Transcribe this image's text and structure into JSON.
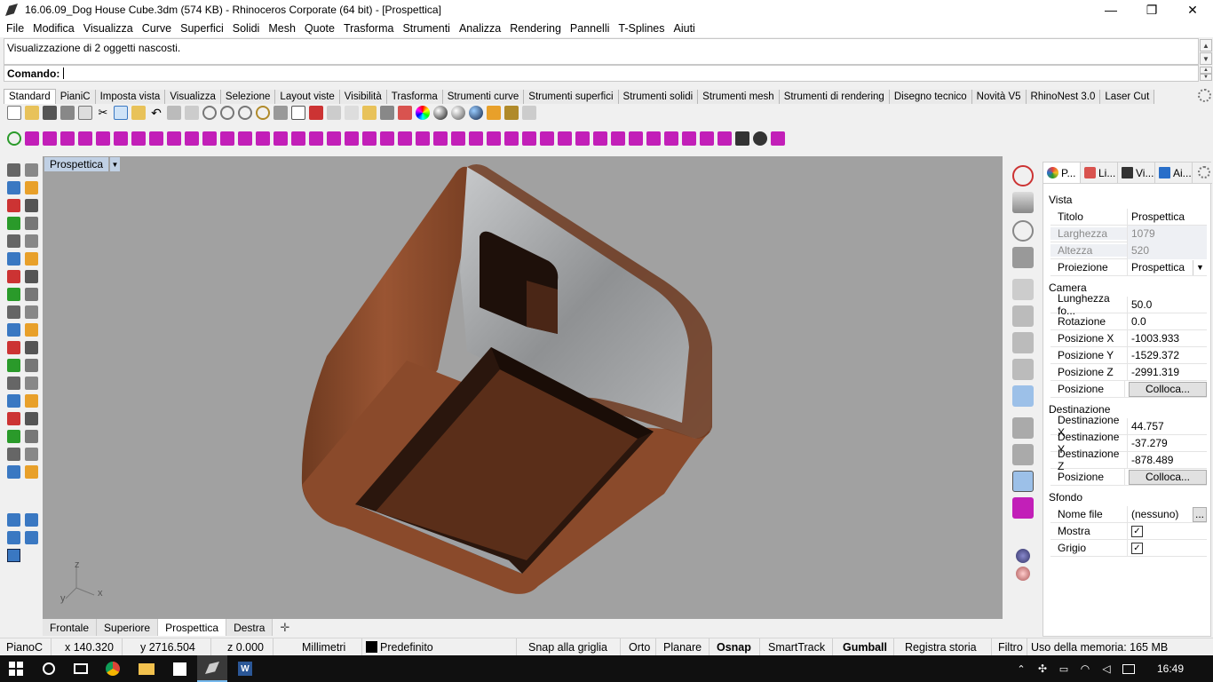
{
  "window": {
    "title": "16.06.09_Dog House Cube.3dm (574 KB) - Rhinoceros Corporate (64 bit) - [Prospettica]",
    "minimize": "—",
    "restore": "❐",
    "close": "✕"
  },
  "menu": [
    "File",
    "Modifica",
    "Visualizza",
    "Curve",
    "Superfici",
    "Solidi",
    "Mesh",
    "Quote",
    "Trasforma",
    "Strumenti",
    "Analizza",
    "Rendering",
    "Pannelli",
    "T-Splines",
    "Aiuti"
  ],
  "command": {
    "history": "Visualizzazione di 2 oggetti nascosti.",
    "prompt": "Comando:"
  },
  "toolbar_tabs": [
    "Standard",
    "PianiC",
    "Imposta vista",
    "Visualizza",
    "Selezione",
    "Layout viste",
    "Visibilità",
    "Trasforma",
    "Strumenti curve",
    "Strumenti superfici",
    "Strumenti solidi",
    "Strumenti mesh",
    "Strumenti di rendering",
    "Disegno tecnico",
    "Novità V5",
    "RhinoNest 3.0",
    "Laser Cut"
  ],
  "viewport": {
    "label": "Prospettica",
    "axes": {
      "z": "z",
      "y": "y",
      "x": "x"
    }
  },
  "viewport_tabs": [
    "Frontale",
    "Superiore",
    "Prospettica",
    "Destra"
  ],
  "panel": {
    "tabs": [
      {
        "label": "P...",
        "color": "#e8413a"
      },
      {
        "label": "Li...",
        "color": "#d9534f"
      },
      {
        "label": "Vi...",
        "color": "#333333"
      },
      {
        "label": "Ai...",
        "color": "#2a6fc9"
      }
    ],
    "sections": {
      "vista": "Vista",
      "camera": "Camera",
      "destinazione": "Destinazione",
      "sfondo": "Sfondo"
    },
    "vista_rows": [
      {
        "k": "Titolo",
        "v": "Prospettica"
      },
      {
        "k": "Larghezza",
        "v": "1079"
      },
      {
        "k": "Altezza",
        "v": "520"
      },
      {
        "k": "Proiezione",
        "v": "Prospettica"
      }
    ],
    "camera_rows": [
      {
        "k": "Lunghezza fo...",
        "v": "50.0"
      },
      {
        "k": "Rotazione",
        "v": "0.0"
      },
      {
        "k": "Posizione X",
        "v": "-1003.933"
      },
      {
        "k": "Posizione Y",
        "v": "-1529.372"
      },
      {
        "k": "Posizione Z",
        "v": "-2991.319"
      },
      {
        "k": "Posizione",
        "v": "Colloca..."
      }
    ],
    "dest_rows": [
      {
        "k": "Destinazione X",
        "v": "44.757"
      },
      {
        "k": "Destinazione Y",
        "v": "-37.279"
      },
      {
        "k": "Destinazione Z",
        "v": "-878.489"
      },
      {
        "k": "Posizione",
        "v": "Colloca..."
      }
    ],
    "sfondo_rows": [
      {
        "k": "Nome file",
        "v": "(nessuno)"
      },
      {
        "k": "Mostra",
        "v": "✓"
      },
      {
        "k": "Grigio",
        "v": "✓"
      }
    ],
    "browse": "..."
  },
  "status": {
    "layer": "PianoC",
    "x": "x 140.320",
    "y": "y 2716.504",
    "z": "z 0.000",
    "units": "Millimetri",
    "layer_color": "#000000",
    "default_layer": "Predefinito",
    "snap": "Snap alla griglia",
    "orto": "Orto",
    "planare": "Planare",
    "osnap": "Osnap",
    "smarttrack": "SmartTrack",
    "gumball": "Gumball",
    "history": "Registra storia",
    "filtro": "Filtro",
    "memory": "Uso della memoria: 165 MB"
  },
  "taskbar": {
    "time": "16:49"
  },
  "colors": {
    "wood": "#8a4a2b",
    "wood_dark": "#5a2e19",
    "steel": "#9ea0a3",
    "viewport_bg": "#a1a1a1",
    "magenta": "#c21fb8"
  }
}
